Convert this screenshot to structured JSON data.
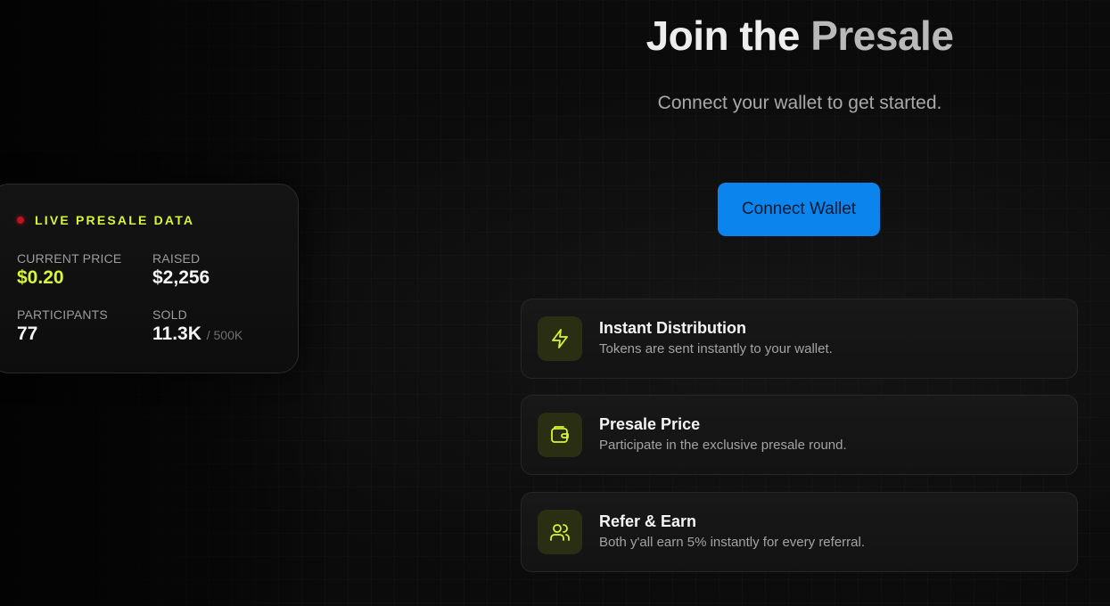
{
  "header": {
    "title_part1": "Join the",
    "title_part2": "Presale",
    "subtitle": "Connect your wallet to get started.",
    "connect_button": "Connect Wallet"
  },
  "live_card": {
    "label": "LIVE PRESALE DATA",
    "current_price_label": "CURRENT PRICE",
    "current_price_value": "$0.20",
    "raised_label": "RAISED",
    "raised_value": "$2,256",
    "participants_label": "PARTICIPANTS",
    "participants_value": "77",
    "sold_label": "SOLD",
    "sold_value": "11.3K",
    "sold_total": "/ 500K"
  },
  "features": [
    {
      "icon": "lightning-icon",
      "title": "Instant Distribution",
      "description": "Tokens are sent instantly to your wallet."
    },
    {
      "icon": "wallet-icon",
      "title": "Presale Price",
      "description": "Participate in the exclusive presale round."
    },
    {
      "icon": "users-icon",
      "title": "Refer & Earn",
      "description": "Both y'all earn 5% instantly for every referral."
    }
  ],
  "colors": {
    "accent": "#d7f53a",
    "button": "#0c84ee",
    "live_dot": "#c1121f",
    "background": "#0b0b0b"
  }
}
